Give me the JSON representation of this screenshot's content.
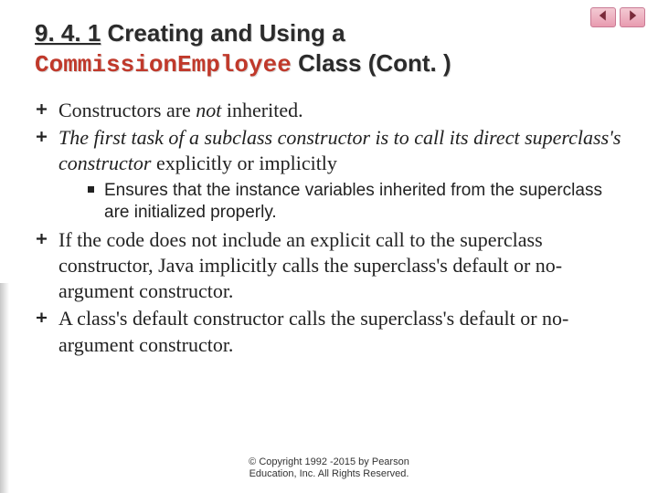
{
  "title": {
    "number": "9. 4. 1",
    "pre": "Creating and Using a",
    "code": "CommissionEmployee",
    "post": "Class (Cont. )"
  },
  "bullets": {
    "b1_pre": "Constructors are ",
    "b1_em": "not",
    "b1_post": " inherited.",
    "b2_em": "The first task of a subclass constructor is to call its direct superclass's constructor",
    "b2_post": " explicitly or implicitly",
    "b2_sub": "Ensures that the instance variables inherited from the superclass are initialized properly.",
    "b3": "If the code does not include an explicit call to the superclass constructor, Java implicitly calls the superclass's default or no-argument constructor.",
    "b4": "A class's default constructor calls the superclass's default or no-argument constructor."
  },
  "copyright_l1": "© Copyright 1992 -2015 by Pearson",
  "copyright_l2": "Education, Inc. All Rights Reserved."
}
